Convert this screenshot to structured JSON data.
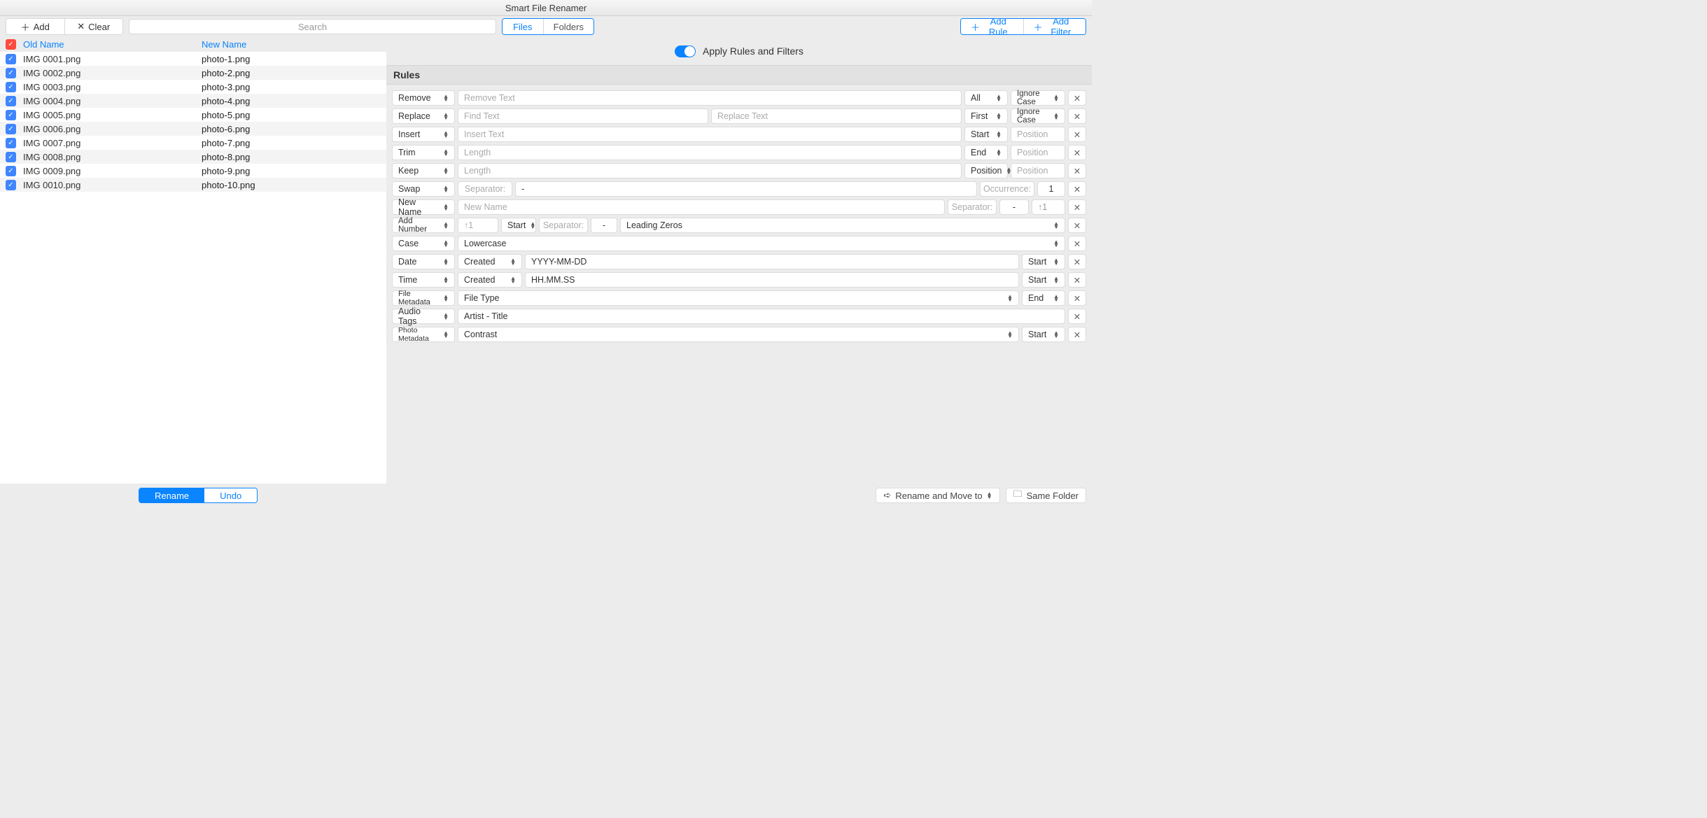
{
  "title": "Smart File Renamer",
  "toolbar": {
    "add": "Add",
    "clear": "Clear",
    "search_ph": "Search",
    "files": "Files",
    "folders": "Folders",
    "addRule": "Add Rule",
    "addFilter": "Add Filter"
  },
  "apply": "Apply Rules and Filters",
  "hdr": {
    "old": "Old Name",
    "new": "New Name"
  },
  "files": [
    {
      "o": "IMG 0001.png",
      "n": "photo-1.png"
    },
    {
      "o": "IMG 0002.png",
      "n": "photo-2.png"
    },
    {
      "o": "IMG 0003.png",
      "n": "photo-3.png"
    },
    {
      "o": "IMG 0004.png",
      "n": "photo-4.png"
    },
    {
      "o": "IMG 0005.png",
      "n": "photo-5.png"
    },
    {
      "o": "IMG 0006.png",
      "n": "photo-6.png"
    },
    {
      "o": "IMG 0007.png",
      "n": "photo-7.png"
    },
    {
      "o": "IMG 0008.png",
      "n": "photo-8.png"
    },
    {
      "o": "IMG 0009.png",
      "n": "photo-9.png"
    },
    {
      "o": "IMG 0010.png",
      "n": "photo-10.png"
    }
  ],
  "rulesHdr": "Rules",
  "rules": {
    "remove": "Remove",
    "removeText": "Remove Text",
    "all": "All",
    "ignoreCase": "Ignore Case",
    "replace": "Replace",
    "findText": "Find Text",
    "replaceText": "Replace Text",
    "first": "First",
    "insert": "Insert",
    "insertText": "Insert Text",
    "start": "Start",
    "position": "Position",
    "trim": "Trim",
    "length": "Length",
    "end": "End",
    "keep": "Keep",
    "swap": "Swap",
    "separator": "Separator:",
    "dash": "-",
    "occurrence": "Occurrence:",
    "one": "1",
    "newName": "New Name",
    "newNamePh": "New Name",
    "upOne": "1",
    "addNumber": "Add Number",
    "leadingZeros": "Leading Zeros",
    "case": "Case",
    "lowercase": "Lowercase",
    "date": "Date",
    "created": "Created",
    "ymd": "YYYY-MM-DD",
    "time": "Time",
    "hms": "HH.MM.SS",
    "fileMeta": "File Metadata",
    "fileType": "File Type",
    "audio": "Audio Tags",
    "artistTitle": "Artist - Title",
    "photo": "Photo Metadata",
    "contrast": "Contrast"
  },
  "footer": {
    "rename": "Rename",
    "undo": "Undo",
    "renameMove": "Rename and Move to",
    "sameFolder": "Same Folder"
  }
}
